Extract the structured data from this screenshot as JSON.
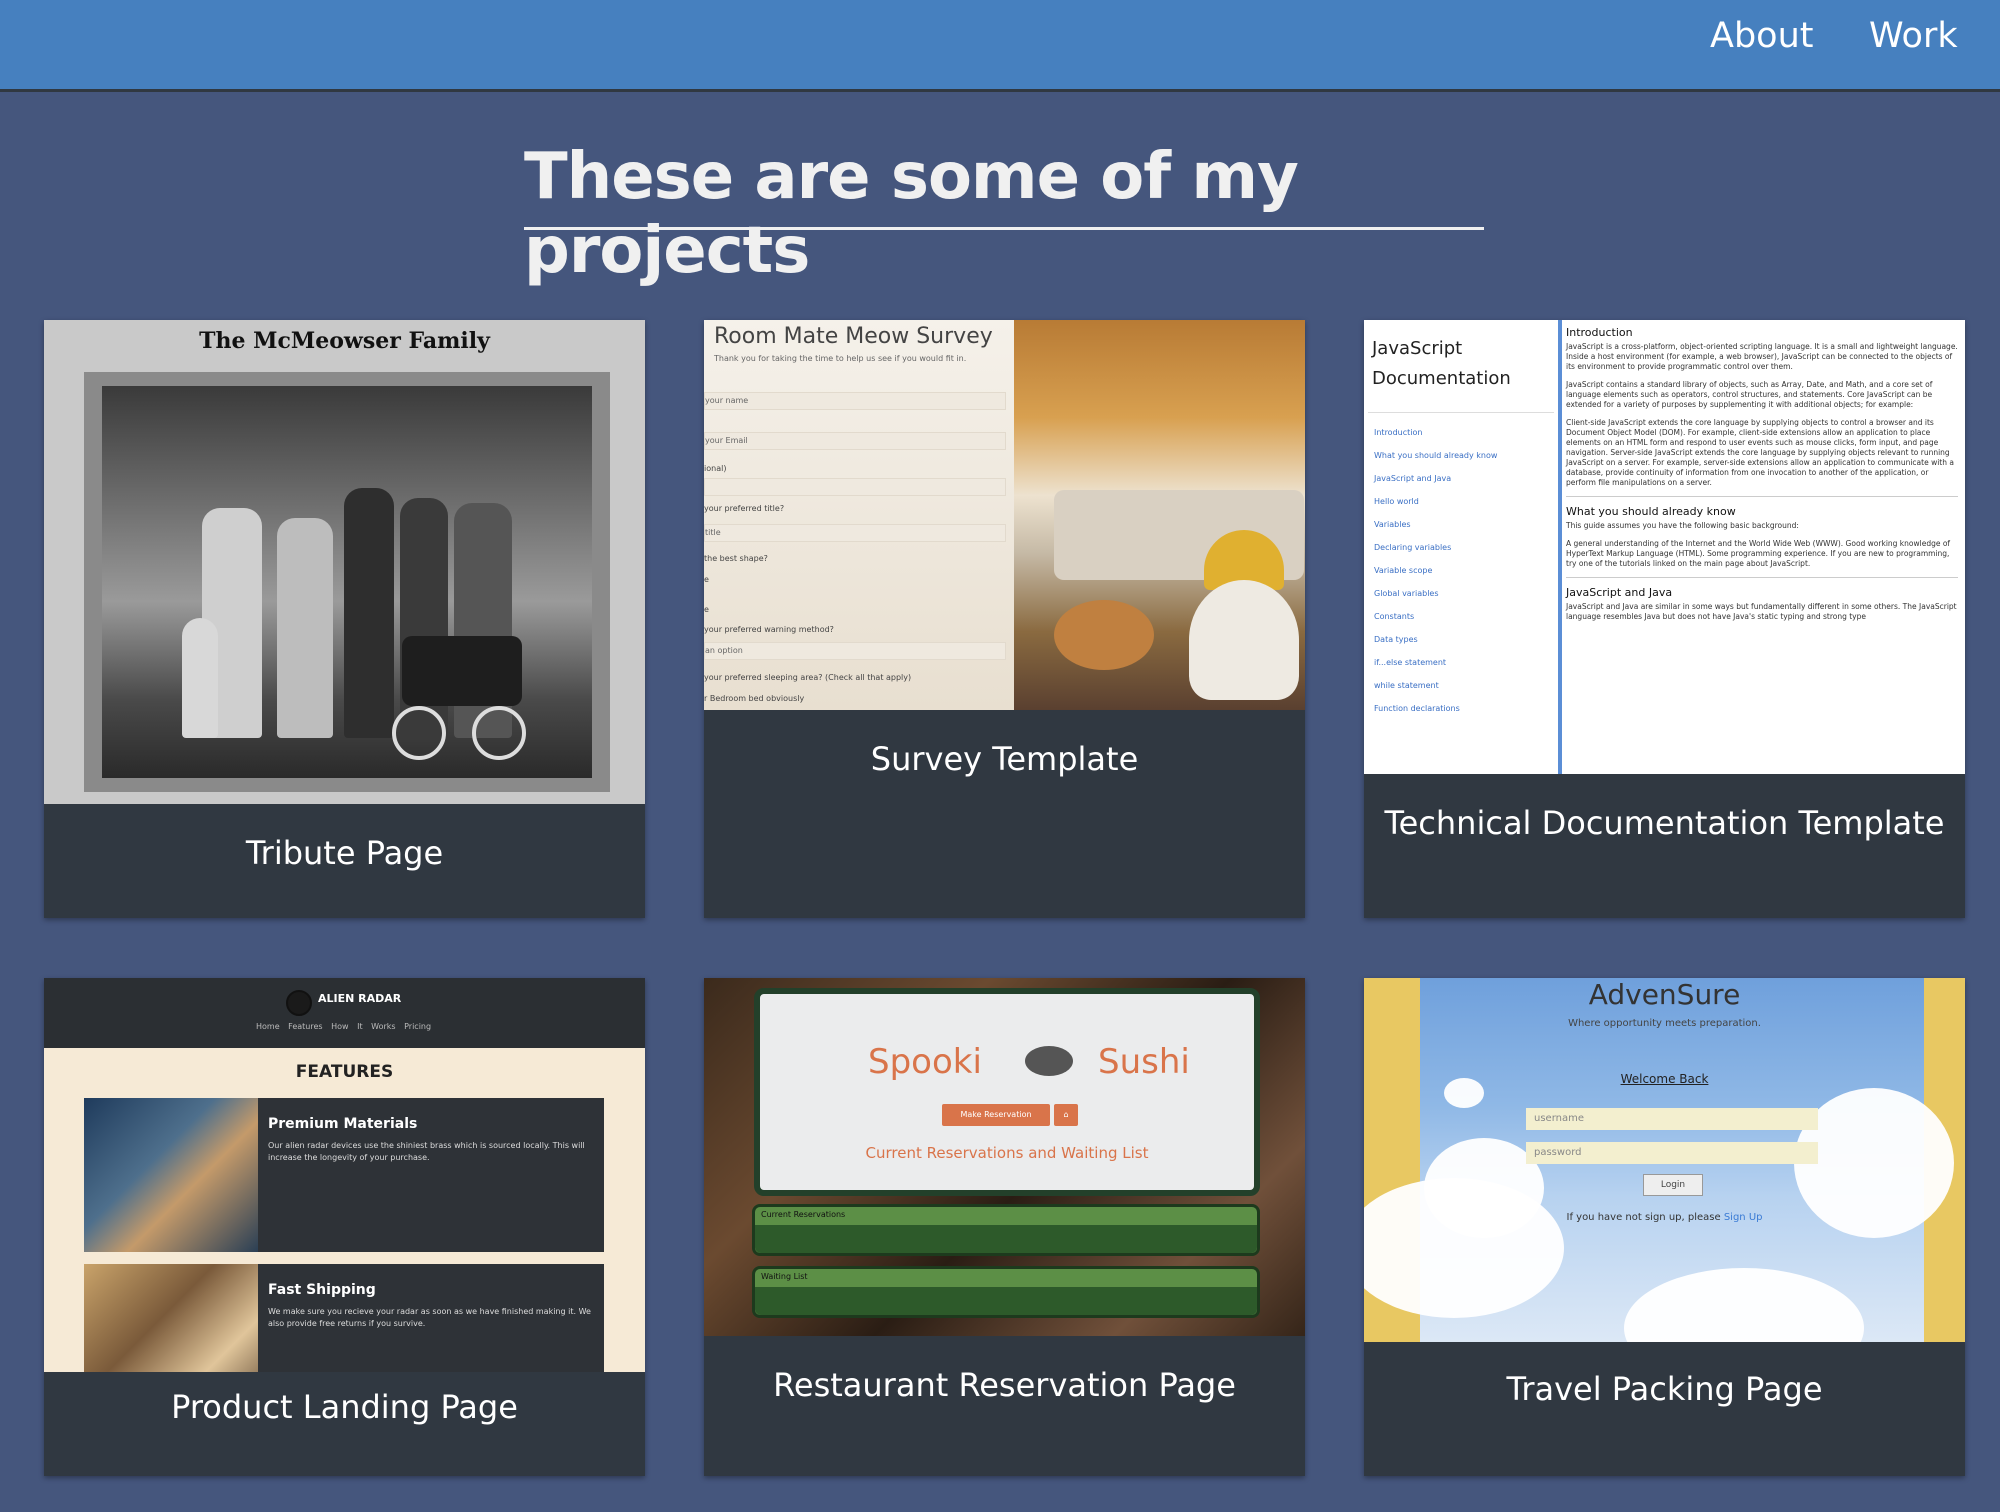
{
  "nav": {
    "links": [
      {
        "label": "About"
      },
      {
        "label": "Work"
      }
    ]
  },
  "header": {
    "title": "These are some of my projects"
  },
  "projects": [
    {
      "caption": "Tribute Page",
      "thumb": {
        "heading": "The McMeowser Family"
      }
    },
    {
      "caption": "Survey Template",
      "thumb": {
        "title": "Room Mate Meow Survey",
        "subtitle": "Thank you for taking the time to help us see if you would fit in.",
        "labels": [
          "your name",
          "your Email",
          "ional)",
          "your preferred title?",
          "title",
          "the best shape?",
          "e",
          "e",
          "your preferred warning method?",
          "an option",
          "your preferred sleeping area? (Check all that apply)",
          "r Bedroom bed obviously"
        ]
      }
    },
    {
      "caption": "Technical Documentation Template",
      "thumb": {
        "nav_title": "JavaScript Documentation",
        "nav_links": [
          "Introduction",
          "What you should already know",
          "JavaScript and Java",
          "Hello world",
          "Variables",
          "Declaring variables",
          "Variable scope",
          "Global variables",
          "Constants",
          "Data types",
          "if...else statement",
          "while statement",
          "Function declarations"
        ],
        "sections": [
          {
            "heading": "Introduction",
            "paragraphs": [
              "JavaScript is a cross-platform, object-oriented scripting language. It is a small and lightweight language. Inside a host environment (for example, a web browser), JavaScript can be connected to the objects of its environment to provide programmatic control over them.",
              "JavaScript contains a standard library of objects, such as Array, Date, and Math, and a core set of language elements such as operators, control structures, and statements. Core JavaScript can be extended for a variety of purposes by supplementing it with additional objects; for example:",
              "Client-side JavaScript extends the core language by supplying objects to control a browser and its Document Object Model (DOM). For example, client-side extensions allow an application to place elements on an HTML form and respond to user events such as mouse clicks, form input, and page navigation. Server-side JavaScript extends the core language by supplying objects relevant to running JavaScript on a server. For example, server-side extensions allow an application to communicate with a database, provide continuity of information from one invocation to another of the application, or perform file manipulations on a server."
            ]
          },
          {
            "heading": "What you should already know",
            "paragraphs": [
              "This guide assumes you have the following basic background:",
              "A general understanding of the Internet and the World Wide Web (WWW). Good working knowledge of HyperText Markup Language (HTML). Some programming experience. If you are new to programming, try one of the tutorials linked on the main page about JavaScript."
            ]
          },
          {
            "heading": "JavaScript and Java",
            "paragraphs": [
              "JavaScript and Java are similar in some ways but fundamentally different in some others. The JavaScript language resembles Java but does not have Java's static typing and strong type"
            ]
          }
        ]
      }
    },
    {
      "caption": "Product Landing Page",
      "thumb": {
        "brand": "ALIEN RADAR",
        "links": "Home Features How It Works Pricing",
        "heading": "FEATURES",
        "items": [
          {
            "title": "Premium Materials",
            "text": "Our alien radar devices use the shiniest brass which is sourced locally. This will increase the longevity of your purchase."
          },
          {
            "title": "Fast Shipping",
            "text": "We make sure you recieve your radar as soon as we have finished making it. We also provide free returns if you survive."
          }
        ]
      }
    },
    {
      "caption": "Restaurant Reservation Page",
      "thumb": {
        "brand_left": "Spooki",
        "brand_right": "Sushi",
        "reserve_button": "Make Reservation",
        "home_button": "⌂",
        "list_title": "Current Reservations and Waiting List",
        "bars": [
          "Current Reservations",
          "Waiting List"
        ]
      }
    },
    {
      "caption": "Travel Packing Page",
      "thumb": {
        "name": "AdvenSure",
        "tagline": "Where opportunity meets preparation.",
        "welcome": "Welcome Back",
        "username_placeholder": "username",
        "password_placeholder": "password",
        "login_label": "Login",
        "signup_text": "If you have not sign up, please ",
        "signup_link": "Sign Up"
      }
    }
  ]
}
